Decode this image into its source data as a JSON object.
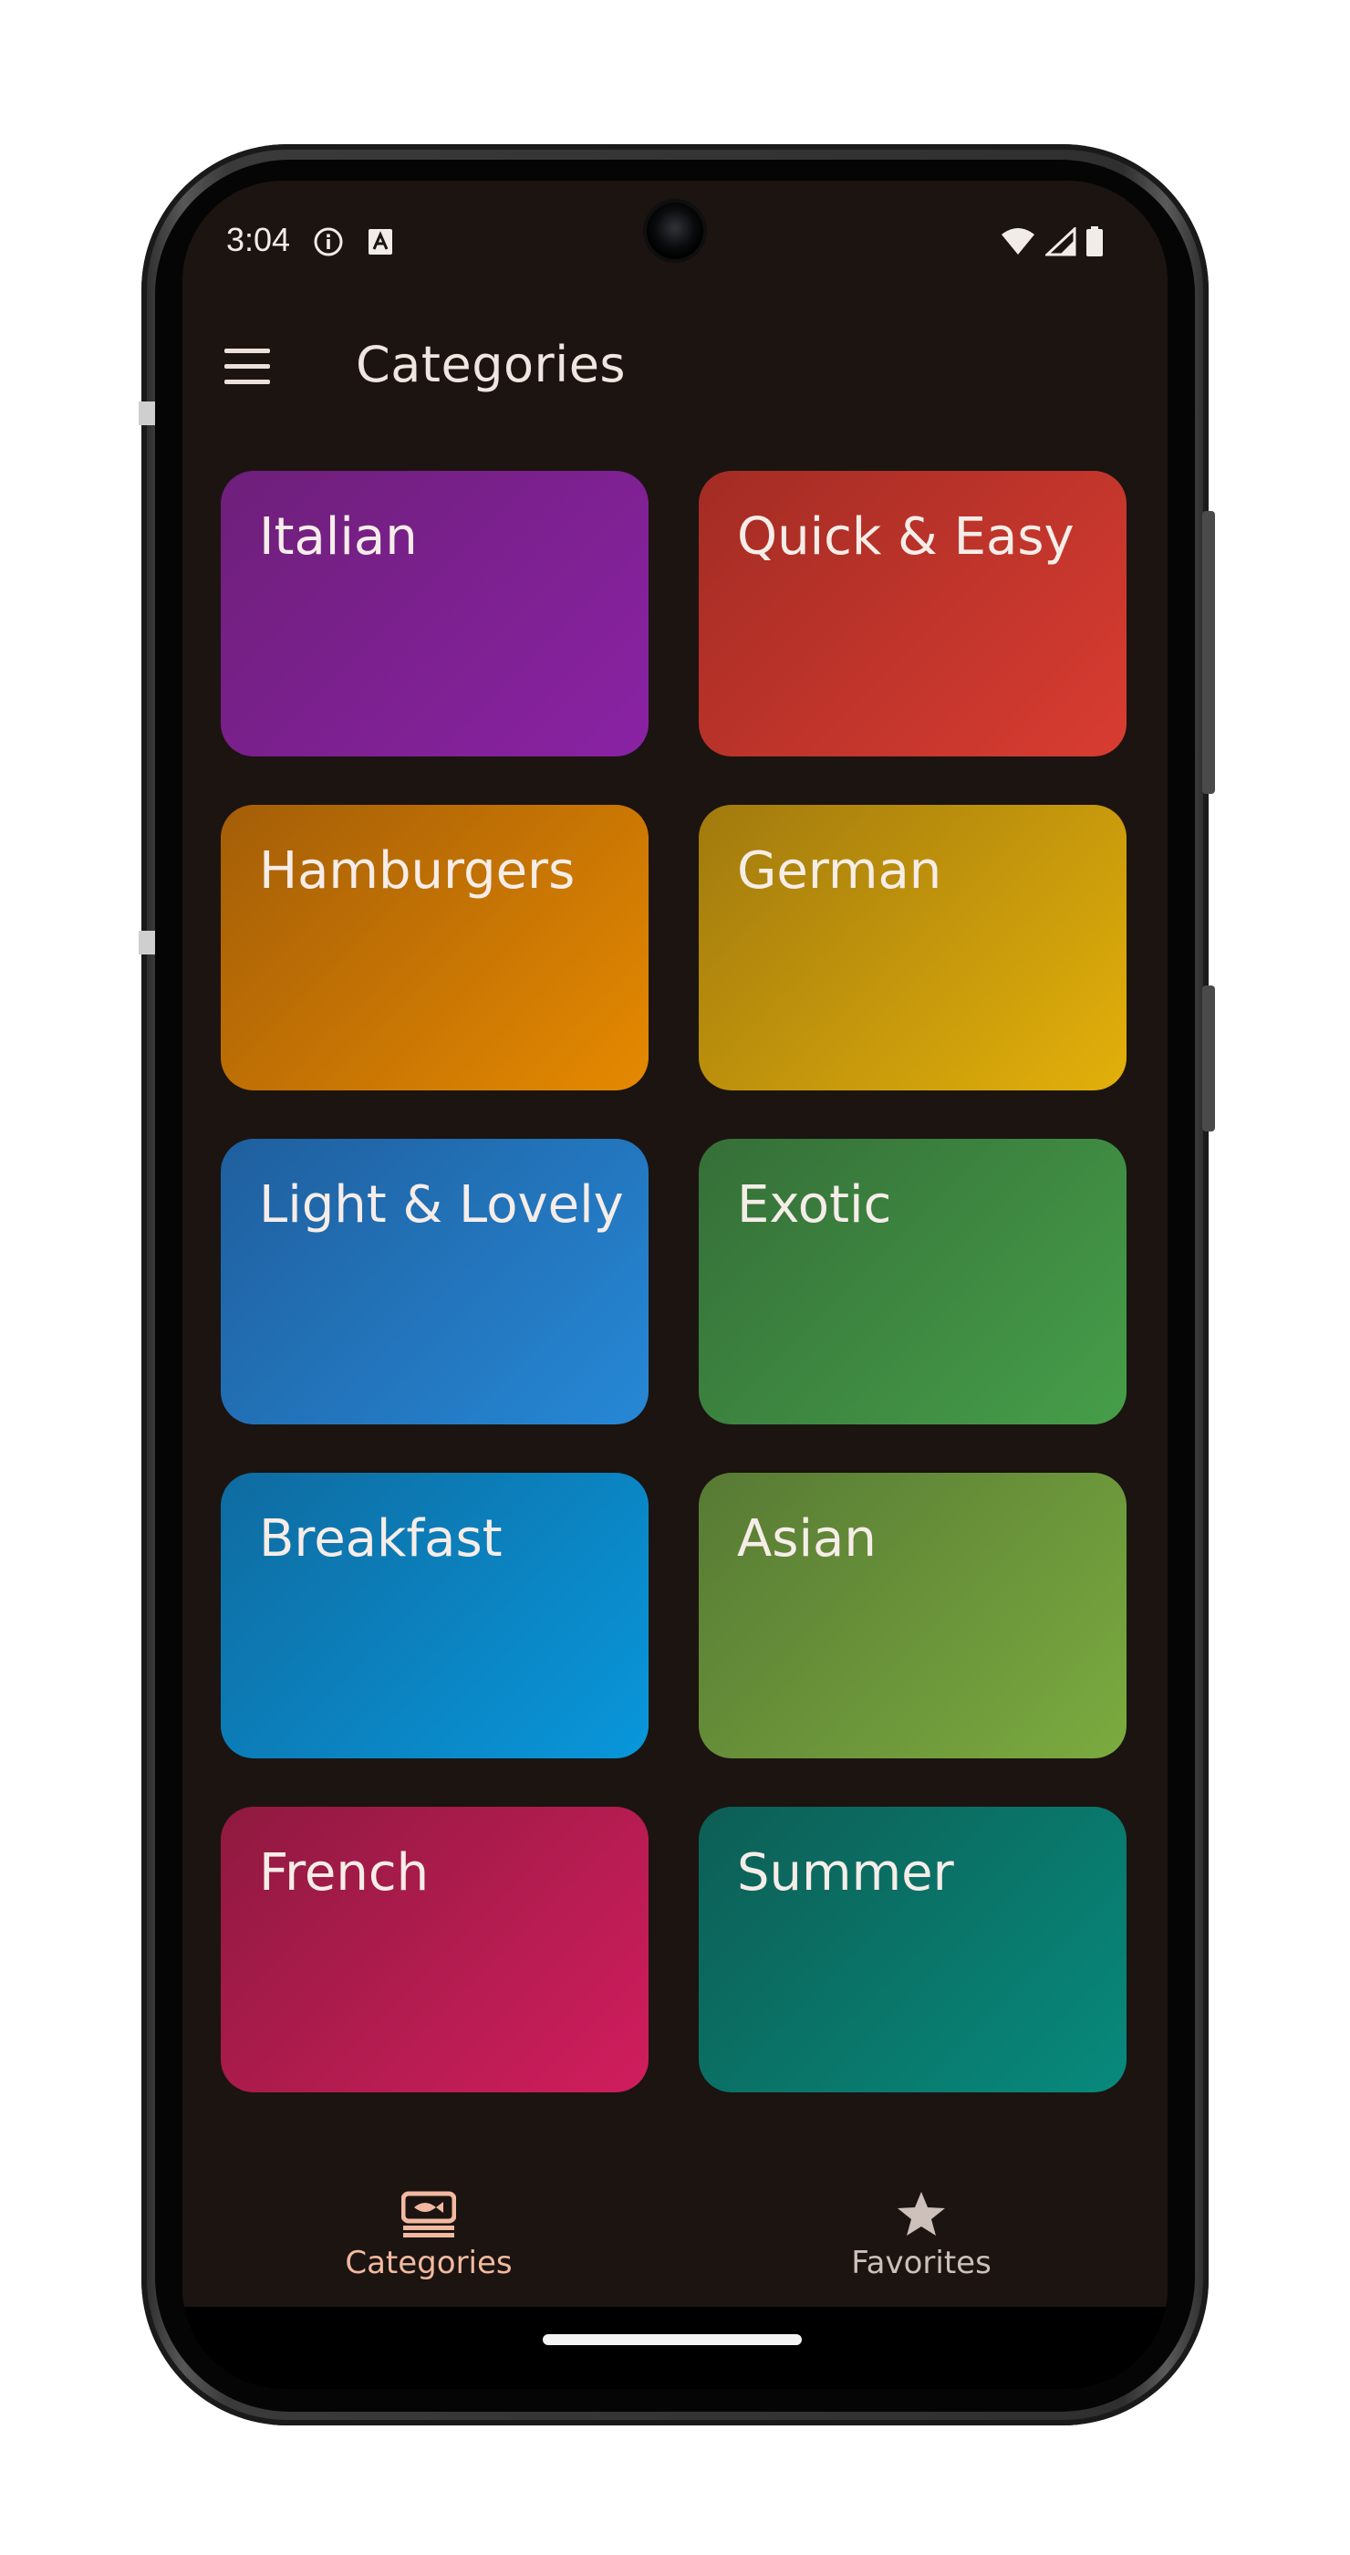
{
  "status_bar": {
    "time": "3:04",
    "icons": [
      "info-icon",
      "a-notification-icon",
      "wifi-icon",
      "signal-icon",
      "battery-icon"
    ]
  },
  "app_bar": {
    "title": "Categories",
    "menu_icon": "menu-icon"
  },
  "categories": [
    {
      "label": "Italian",
      "color_from": "#6e1f7a",
      "color_to": "#8a22a4"
    },
    {
      "label": "Quick & Easy",
      "color_from": "#a32c24",
      "color_to": "#d93c31"
    },
    {
      "label": "Hamburgers",
      "color_from": "#a45e08",
      "color_to": "#e58900"
    },
    {
      "label": "German",
      "color_from": "#a17a0e",
      "color_to": "#e3b00a"
    },
    {
      "label": "Light & Lovely",
      "color_from": "#1f5f9e",
      "color_to": "#2688d6"
    },
    {
      "label": "Exotic",
      "color_from": "#356f38",
      "color_to": "#469e49"
    },
    {
      "label": "Breakfast",
      "color_from": "#0f6ba0",
      "color_to": "#0897db"
    },
    {
      "label": "Asian",
      "color_from": "#577a34",
      "color_to": "#7bab3f"
    },
    {
      "label": "French",
      "color_from": "#8f1a40",
      "color_to": "#d11d5d"
    },
    {
      "label": "Summer",
      "color_from": "#0d5e55",
      "color_to": "#078a7c"
    }
  ],
  "bottom_nav": {
    "items": [
      {
        "label": "Categories",
        "icon": "categories-icon",
        "selected": true,
        "color": "#f2b9a0"
      },
      {
        "label": "Favorites",
        "icon": "star-icon",
        "selected": false,
        "color": "#cdbfb9"
      }
    ]
  }
}
